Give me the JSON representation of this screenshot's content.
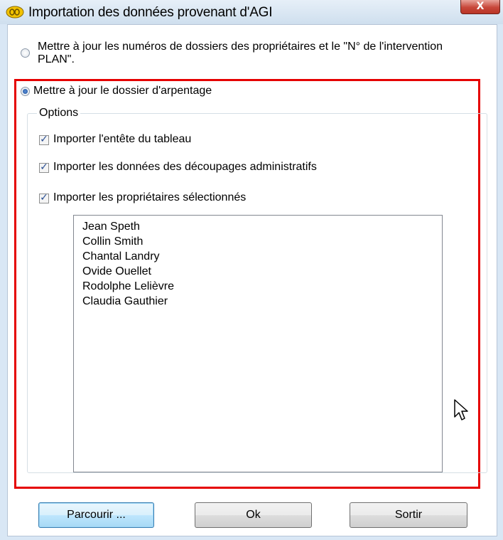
{
  "window": {
    "title": "Importation des données provenant d'AGI",
    "close_label": "X"
  },
  "options": {
    "radio_update_numbers": {
      "line1": "Mettre à jour les numéros de dossiers des propriétaires et le \"N° de l'intervention",
      "line2": "PLAN\".",
      "selected": false
    },
    "radio_update_survey": {
      "label": "Mettre à jour le dossier d'arpentage",
      "selected": true
    },
    "group_label": "Options",
    "checkboxes": [
      {
        "label": "Importer l'entête du tableau",
        "checked": true
      },
      {
        "label": "Importer les données des découpages administratifs",
        "checked": true
      },
      {
        "label": "Importer les propriétaires sélectionnés",
        "checked": true
      }
    ],
    "owners": [
      "Jean Speth",
      "Collin Smith",
      "Chantal Landry",
      "Ovide Ouellet",
      "Rodolphe Lelièvre",
      "Claudia Gauthier"
    ]
  },
  "buttons": {
    "browse": "Parcourir ...",
    "ok": "Ok",
    "exit": "Sortir"
  },
  "colors": {
    "highlight_frame": "#e50000",
    "checkmark": "#2a4f93"
  }
}
